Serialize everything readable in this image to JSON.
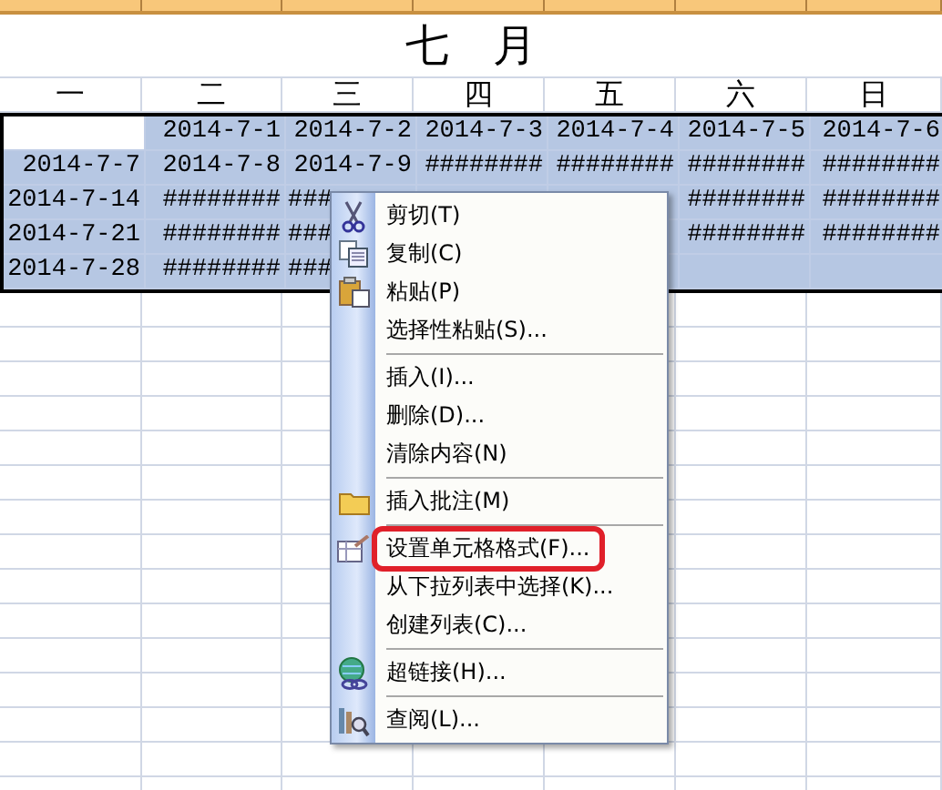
{
  "sheet": {
    "title": "七　月",
    "weekdays": [
      "一",
      "二",
      "三",
      "四",
      "五",
      "六",
      "日"
    ],
    "rows": [
      {
        "cells": [
          null,
          "2014-7-1",
          "2014-7-2",
          "2014-7-3",
          "2014-7-4",
          "2014-7-5",
          "2014-7-6"
        ]
      },
      {
        "cells": [
          "2014-7-7",
          "2014-7-8",
          "2014-7-9",
          "########",
          "########",
          "########",
          "########"
        ]
      },
      {
        "cells": [
          "2014-7-14",
          "########",
          "###",
          null,
          null,
          "########",
          "########"
        ]
      },
      {
        "cells": [
          "2014-7-21",
          "########",
          "###",
          null,
          null,
          "########",
          "########"
        ]
      },
      {
        "cells": [
          "2014-7-28",
          "########",
          "###",
          null,
          null,
          null,
          null
        ]
      }
    ]
  },
  "context_menu": {
    "groups": [
      {
        "items": [
          {
            "label": "剪切(T)",
            "highlighted": false
          },
          {
            "label": "复制(C)",
            "highlighted": false
          },
          {
            "label": "粘贴(P)",
            "highlighted": false
          },
          {
            "label": "选择性粘贴(S)...",
            "highlighted": false
          }
        ]
      },
      {
        "items": [
          {
            "label": "插入(I)...",
            "highlighted": false
          },
          {
            "label": "删除(D)...",
            "highlighted": false
          },
          {
            "label": "清除内容(N)",
            "highlighted": false
          }
        ]
      },
      {
        "items": [
          {
            "label": "插入批注(M)",
            "highlighted": false
          }
        ]
      },
      {
        "items": [
          {
            "label": "设置单元格格式(F)...",
            "highlighted": true
          },
          {
            "label": "从下拉列表中选择(K)...",
            "highlighted": false
          },
          {
            "label": "创建列表(C)...",
            "highlighted": false
          }
        ]
      },
      {
        "items": [
          {
            "label": "超链接(H)...",
            "highlighted": false
          }
        ]
      },
      {
        "items": [
          {
            "label": "查阅(L)...",
            "highlighted": false
          }
        ]
      }
    ]
  }
}
